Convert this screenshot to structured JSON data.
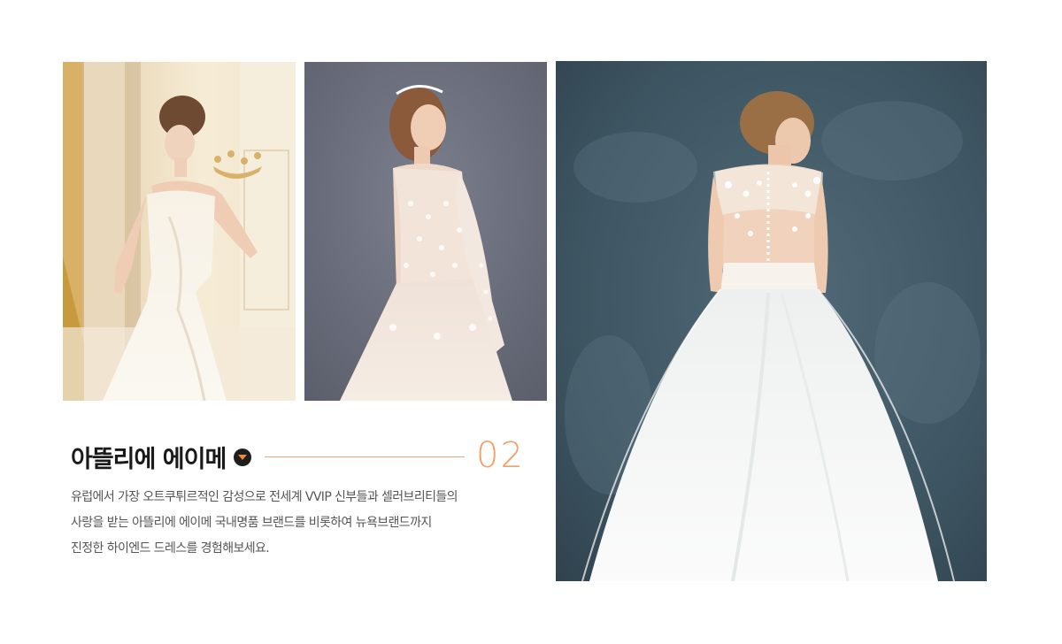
{
  "brand": {
    "name": "아뜰리에 에이메",
    "number": "02",
    "description": [
      "유럽에서 가장 오트쿠튀르적인 감성으로 전세계 VVIP 신부들과 셀러브리티들의",
      "사랑을 받는 아뜰리에 에이메 국내명품 브랜드를 비롯하여 뉴욕브랜드까지",
      "진정한 하이엔드 드레스를 경험해보세요."
    ]
  },
  "colors": {
    "accent": "#f2a06a",
    "line": "#e3a87a",
    "toggle_bg": "#1e1e1e",
    "toggle_arrow": "#f08a3c",
    "title": "#1a1a1a",
    "body_text": "#555555"
  },
  "icons": {
    "toggle": "chevron-down-circle-icon"
  }
}
